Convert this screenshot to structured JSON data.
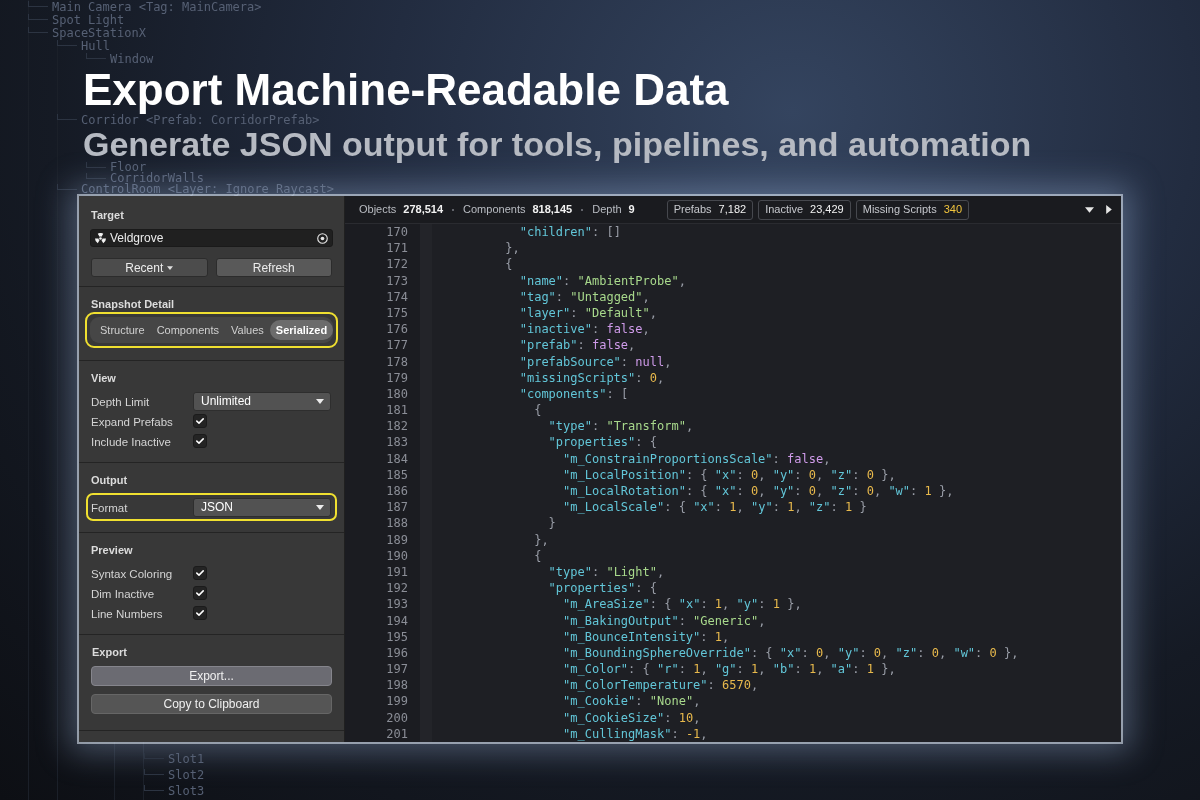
{
  "background_tree": {
    "upper_items": [
      {
        "label": "Main Camera <Tag: MainCamera>"
      },
      {
        "label": "Spot Light"
      },
      {
        "label": "SpaceStationX",
        "children": [
          {
            "label": "Hull",
            "children": [
              {
                "label": "Window"
              }
            ]
          }
        ]
      }
    ],
    "between_headings": [
      {
        "label": "Corridor <Prefab: CorridorPrefab>"
      }
    ],
    "below_headings": [
      {
        "children": [
          {
            "label": "Floor"
          },
          {
            "label": "CorridorWalls"
          }
        ]
      },
      {
        "label": "ControlRoom <Layer: Ignore Raycast>"
      }
    ],
    "bottom_items": [
      {
        "label": "Slot1"
      },
      {
        "label": "Slot2"
      },
      {
        "label": "Slot3"
      }
    ]
  },
  "hero": {
    "title": "Export Machine-Readable Data",
    "subtitle": "Generate JSON output for tools, pipelines, and automation"
  },
  "stats_bar": {
    "stats": [
      {
        "label": "Objects",
        "value": "278,514"
      },
      {
        "label": "Components",
        "value": "818,145"
      },
      {
        "label": "Depth",
        "value": "9"
      }
    ],
    "chips": [
      {
        "label": "Prefabs",
        "value": "7,182",
        "warning": false
      },
      {
        "label": "Inactive",
        "value": "23,429",
        "warning": false
      },
      {
        "label": "Missing Scripts",
        "value": "340",
        "warning": true
      }
    ]
  },
  "inspector": {
    "sections": [
      {
        "kind": "target",
        "title": "Target",
        "object_field": {
          "value": "Veldgrove"
        },
        "buttons": [
          {
            "label": "Recent",
            "menu": true
          },
          {
            "label": "Refresh",
            "menu": false
          }
        ]
      },
      {
        "kind": "segments",
        "title": "Snapshot Detail",
        "highlighted": true,
        "options": [
          {
            "label": "Structure",
            "selected": false
          },
          {
            "label": "Components",
            "selected": false
          },
          {
            "label": "Values",
            "selected": false
          },
          {
            "label": "Serialized",
            "selected": true
          }
        ]
      },
      {
        "kind": "settings",
        "title": "View",
        "rows": [
          {
            "kind": "dropdown",
            "label": "Depth Limit",
            "value": "Unlimited",
            "highlighted": false
          },
          {
            "kind": "checkbox",
            "label": "Expand Prefabs",
            "checked": true,
            "highlighted": false
          },
          {
            "kind": "checkbox",
            "label": "Include Inactive",
            "checked": true,
            "highlighted": false
          }
        ]
      },
      {
        "kind": "settings",
        "title": "Output",
        "rows": [
          {
            "kind": "dropdown",
            "label": "Format",
            "value": "JSON",
            "highlighted": true
          }
        ]
      },
      {
        "kind": "settings",
        "title": "Preview",
        "rows": [
          {
            "kind": "checkbox",
            "label": "Syntax Coloring",
            "checked": true,
            "highlighted": false
          },
          {
            "kind": "checkbox",
            "label": "Dim Inactive",
            "checked": true,
            "highlighted": false
          },
          {
            "kind": "checkbox",
            "label": "Line Numbers",
            "checked": true,
            "highlighted": false
          }
        ]
      },
      {
        "kind": "actions",
        "title": "Export",
        "buttons": [
          {
            "label": "Export...",
            "primary": true
          },
          {
            "label": "Copy to Clipboard",
            "primary": false
          }
        ]
      }
    ]
  },
  "code_view": {
    "lines": [
      {
        "number": "170",
        "text": "            \"children\": []"
      },
      {
        "number": "171",
        "text": "          },"
      },
      {
        "number": "172",
        "text": "          {"
      },
      {
        "number": "173",
        "text": "            \"name\": \"AmbientProbe\","
      },
      {
        "number": "174",
        "text": "            \"tag\": \"Untagged\","
      },
      {
        "number": "175",
        "text": "            \"layer\": \"Default\","
      },
      {
        "number": "176",
        "text": "            \"inactive\": false,"
      },
      {
        "number": "177",
        "text": "            \"prefab\": false,"
      },
      {
        "number": "178",
        "text": "            \"prefabSource\": null,"
      },
      {
        "number": "179",
        "text": "            \"missingScripts\": 0,"
      },
      {
        "number": "180",
        "text": "            \"components\": ["
      },
      {
        "number": "181",
        "text": "              {"
      },
      {
        "number": "182",
        "text": "                \"type\": \"Transform\","
      },
      {
        "number": "183",
        "text": "                \"properties\": {"
      },
      {
        "number": "184",
        "text": "                  \"m_ConstrainProportionsScale\": false,"
      },
      {
        "number": "185",
        "text": "                  \"m_LocalPosition\": { \"x\": 0, \"y\": 0, \"z\": 0 },"
      },
      {
        "number": "186",
        "text": "                  \"m_LocalRotation\": { \"x\": 0, \"y\": 0, \"z\": 0, \"w\": 1 },"
      },
      {
        "number": "187",
        "text": "                  \"m_LocalScale\": { \"x\": 1, \"y\": 1, \"z\": 1 }"
      },
      {
        "number": "188",
        "text": "                }"
      },
      {
        "number": "189",
        "text": "              },"
      },
      {
        "number": "190",
        "text": "              {"
      },
      {
        "number": "191",
        "text": "                \"type\": \"Light\","
      },
      {
        "number": "192",
        "text": "                \"properties\": {"
      },
      {
        "number": "193",
        "text": "                  \"m_AreaSize\": { \"x\": 1, \"y\": 1 },"
      },
      {
        "number": "194",
        "text": "                  \"m_BakingOutput\": \"Generic\","
      },
      {
        "number": "195",
        "text": "                  \"m_BounceIntensity\": 1,"
      },
      {
        "number": "196",
        "text": "                  \"m_BoundingSphereOverride\": { \"x\": 0, \"y\": 0, \"z\": 0, \"w\": 0 },"
      },
      {
        "number": "197",
        "text": "                  \"m_Color\": { \"r\": 1, \"g\": 1, \"b\": 1, \"a\": 1 },"
      },
      {
        "number": "198",
        "text": "                  \"m_ColorTemperature\": 6570,"
      },
      {
        "number": "199",
        "text": "                  \"m_Cookie\": \"None\","
      },
      {
        "number": "200",
        "text": "                  \"m_CookieSize\": 10,"
      },
      {
        "number": "201",
        "text": "                  \"m_CullingMask\": -1,"
      }
    ]
  }
}
